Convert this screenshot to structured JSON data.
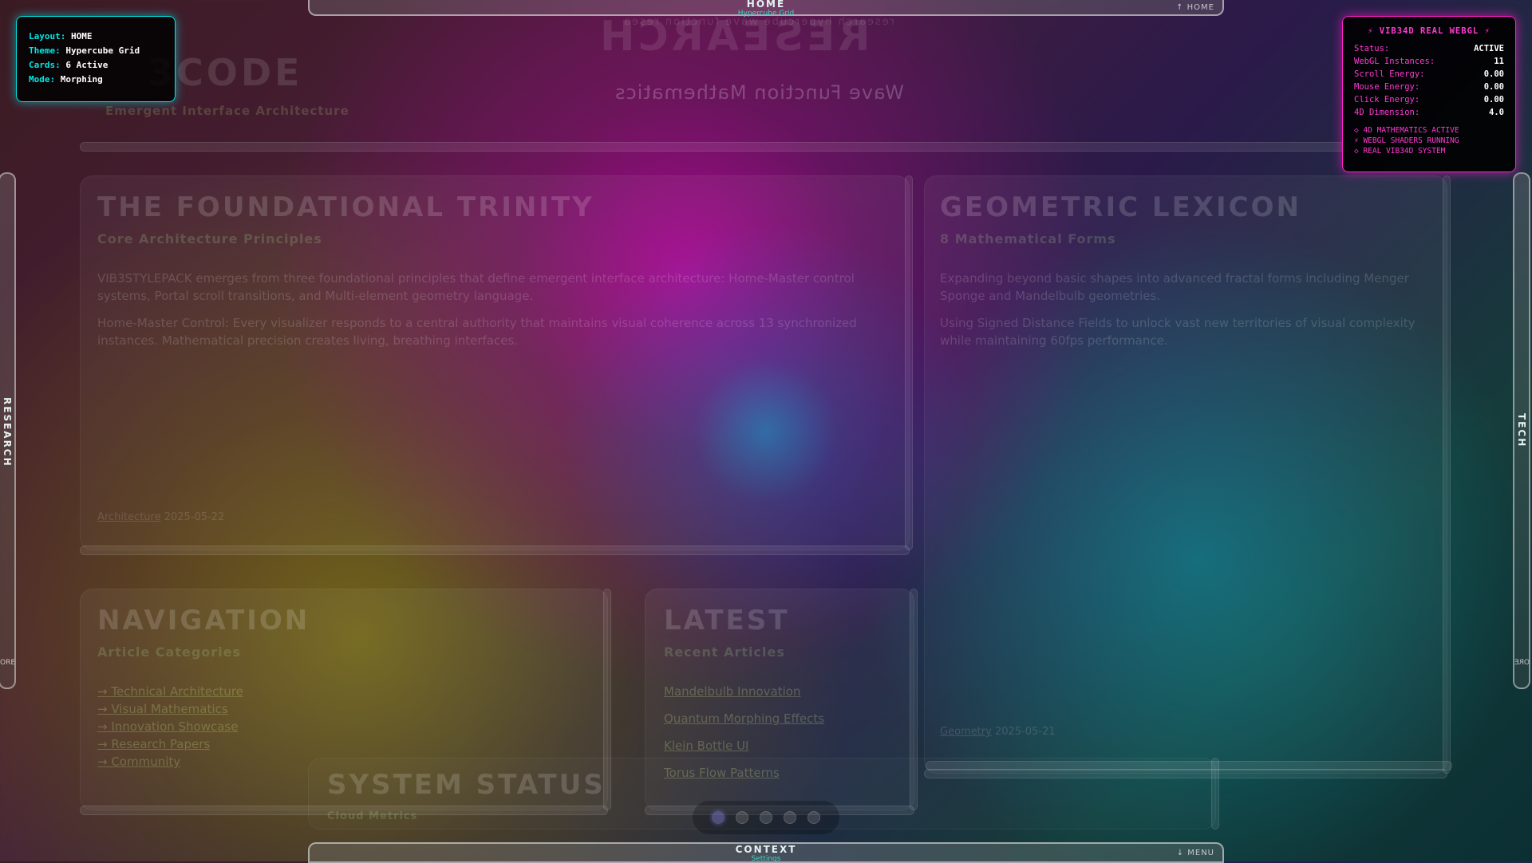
{
  "background": {
    "brand_left": "3CODE",
    "tagline_left": "Emergent Interface Architecture",
    "mirrored_title": "RESEARCH",
    "mirrored_subtitle": "Wave Function Mathematics",
    "top_ghost_text": "research hypercube wave function resea"
  },
  "topbar": {
    "title": "HOME",
    "subtitle": "Hypercube Grid",
    "right_label": "↑ HOME"
  },
  "bottombar": {
    "title": "CONTEXT",
    "subtitle": "Settings",
    "right_label": "↓ MENU"
  },
  "left_side": {
    "label": "RESEARCH",
    "small_label": "ORE"
  },
  "right_side": {
    "label": "TECH",
    "small_label": "ORE"
  },
  "info_panel": {
    "layout_key": "Layout:",
    "layout_val": "HOME",
    "theme_key": "Theme:",
    "theme_val": "Hypercube Grid",
    "cards_key": "Cards:",
    "cards_val": "6 Active",
    "mode_key": "Mode:",
    "mode_val": "Morphing"
  },
  "webgl_panel": {
    "title": "⚡ VIB34D REAL WEBGL ⚡",
    "rows": [
      {
        "k": "Status:",
        "v": "ACTIVE"
      },
      {
        "k": "WebGL Instances:",
        "v": "11"
      },
      {
        "k": "Scroll Energy:",
        "v": "0.00"
      },
      {
        "k": "Mouse Energy:",
        "v": "0.00"
      },
      {
        "k": "Click Energy:",
        "v": "0.00"
      },
      {
        "k": "4D Dimension:",
        "v": "4.0"
      }
    ],
    "flags": [
      "◇ 4D MATHEMATICS ACTIVE",
      "⚡ WEBGL SHADERS RUNNING",
      "◇ REAL VIB34D SYSTEM"
    ],
    "accent_color": "#ff1fc8"
  },
  "cards": {
    "trinity": {
      "title": "THE FOUNDATIONAL TRINITY",
      "subtitle": "Core Architecture Principles",
      "p1": "VIB3STYLEPACK emerges from three foundational principles that define emergent interface architecture: Home-Master control systems, Portal scroll transitions, and Multi-element geometry language.",
      "p2": "Home-Master Control: Every visualizer responds to a central authority that maintains visual coherence across 13 synchronized instances. Mathematical precision creates living, breathing interfaces.",
      "meta_link": "Architecture",
      "meta_date": "2025-05-22"
    },
    "lexicon": {
      "title": "GEOMETRIC LEXICON",
      "subtitle": "8 Mathematical Forms",
      "p1": "Expanding beyond basic shapes into advanced fractal forms including Menger Sponge and Mandelbulb geometries.",
      "p2": "Using Signed Distance Fields to unlock vast new territories of visual complexity while maintaining 60fps performance.",
      "meta_link": "Geometry",
      "meta_date": "2025-05-21"
    },
    "navigation": {
      "title": "NAVIGATION",
      "subtitle": "Article Categories",
      "links": [
        "→ Technical Architecture",
        "→ Visual Mathematics",
        "→ Innovation Showcase",
        "→ Research Papers",
        "→ Community"
      ]
    },
    "latest": {
      "title": "LATEST",
      "subtitle": "Recent Articles",
      "links": [
        "Mandelbulb Innovation",
        "Quantum Morphing Effects",
        "Klein Bottle UI",
        "Torus Flow Patterns"
      ]
    },
    "status": {
      "title": "SYSTEM STATUS",
      "subtitle": "Cloud Metrics"
    }
  },
  "pager": {
    "count": 5,
    "active_index": 0
  }
}
